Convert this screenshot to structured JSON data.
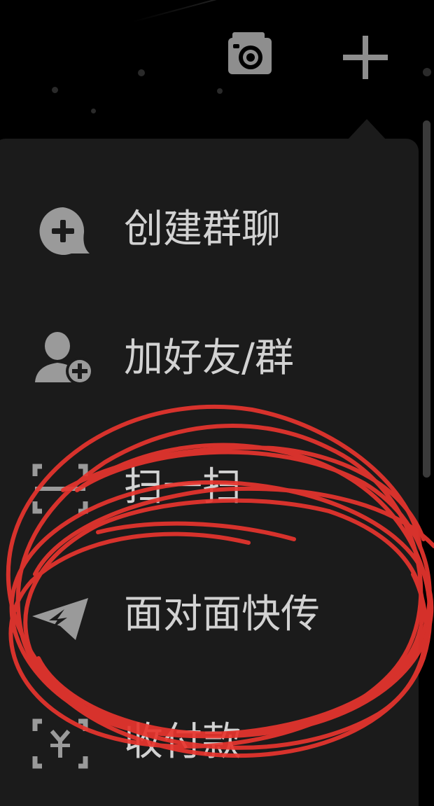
{
  "topbar": {
    "camera_icon": "camera-icon",
    "plus_icon": "plus-icon"
  },
  "menu": {
    "items": [
      {
        "label": "创建群聊",
        "icon": "chat-add-icon"
      },
      {
        "label": "加好友/群",
        "icon": "add-friend-icon"
      },
      {
        "label": "扫一扫",
        "icon": "scan-icon"
      },
      {
        "label": "面对面快传",
        "icon": "paper-plane-icon"
      },
      {
        "label": "收付款",
        "icon": "payment-scan-icon"
      }
    ]
  },
  "annotation": {
    "color": "#e8352e"
  },
  "colors": {
    "menu_background": "#1b1b1b",
    "icon_color": "#9a9a9a",
    "label_color": "#d2d2d2"
  }
}
